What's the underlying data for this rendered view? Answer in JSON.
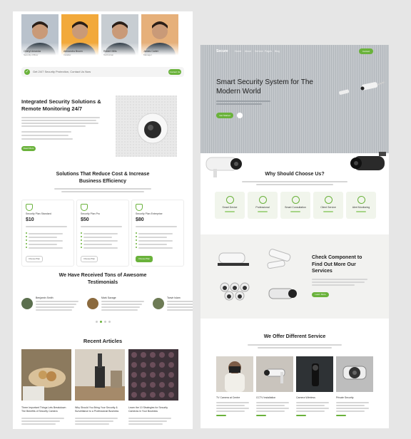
{
  "left": {
    "team": [
      {
        "name": "Cheryl Amanda",
        "role": "Security Officer",
        "bg": "#b9c2cc"
      },
      {
        "name": "Alexandra Brown",
        "role": "Installer",
        "bg": "#f2a93b"
      },
      {
        "name": "Robert Mills",
        "role": "Technician",
        "bg": "#c7cdd2"
      },
      {
        "name": "James Carter",
        "role": "Manager",
        "bg": "#e6b07a"
      }
    ],
    "banner": {
      "text": "Get 24/7 Security Protection, Contact Us Now",
      "button": "Contact Us"
    },
    "integrated": {
      "title": "Integrated Security Solutions & Remote Monitoring 24/7",
      "button": "Read More"
    },
    "solutions": {
      "title": "Solutions That Reduce Cost & Increase Business Efficiency",
      "plans": [
        {
          "name": "Security Plan Standard",
          "price": "$10",
          "button": "Choose Plan"
        },
        {
          "name": "Security Plan Pro",
          "price": "$50",
          "button": "Choose Plan"
        },
        {
          "name": "Security Plan Enterprise",
          "price": "$80",
          "button": "Choose Plan"
        }
      ]
    },
    "testimonials": {
      "title": "We Have Received Tons of Awesome Testimonials",
      "items": [
        {
          "name": "Benjamin Smith"
        },
        {
          "name": "Mark Savage"
        },
        {
          "name": "Tanvir Islam"
        }
      ]
    },
    "articles": {
      "title": "Recent Articles",
      "items": [
        {
          "title": "Three Important Things Lets Breakdown The Benefits of Security Camera"
        },
        {
          "title": "Why Should You Bring Your Security & Surveillance to a Professional Business"
        },
        {
          "title": "Learn the 10 Strategies for Security Cameras in Your Business"
        }
      ]
    }
  },
  "right": {
    "nav": {
      "brand": "Secure",
      "links": [
        "Home",
        "About",
        "Service",
        "Pages",
        "Blog"
      ],
      "cta": "Contact"
    },
    "hero": {
      "title": "Smart Security System for The Modern World",
      "button": "Get Started"
    },
    "why": {
      "title": "Why Should Choose Us?",
      "features": [
        {
          "label": "Smart Device"
        },
        {
          "label": "Professional"
        },
        {
          "label": "Smart Consultation"
        },
        {
          "label": "Client Service"
        },
        {
          "label": "Alert Monitoring"
        }
      ]
    },
    "components": {
      "title": "Check Component to Find Out More Our Services",
      "button": "Learn More"
    },
    "services": {
      "title": "We Offer Different Service",
      "items": [
        {
          "title": "TV Camera at Centre"
        },
        {
          "title": "CCTV Installation"
        },
        {
          "title": "Camera Wireless"
        },
        {
          "title": "Private Security"
        }
      ]
    }
  },
  "colors": {
    "accent": "#6ab23b",
    "hero_bg": "#c3c7cb",
    "section_gray": "#f2f2f0"
  }
}
